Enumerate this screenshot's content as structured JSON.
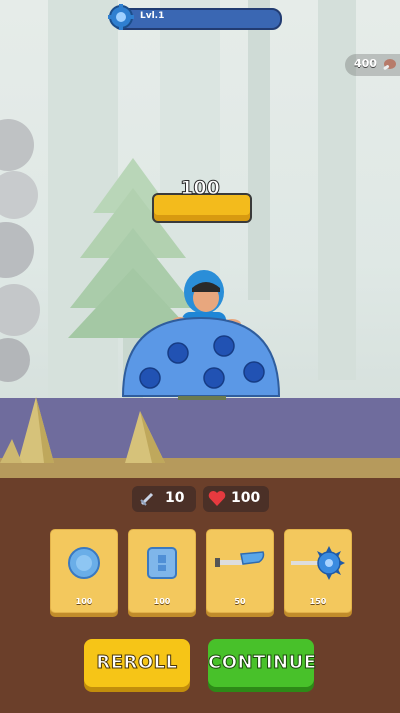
{
  "hud": {
    "level_label": "Lvl.1",
    "coins": "400"
  },
  "enemy": {
    "hp_value": "100"
  },
  "stats": {
    "attack": "10",
    "health": "100"
  },
  "shop": {
    "items": [
      {
        "icon": "blue-disc-icon",
        "price": "100"
      },
      {
        "icon": "blue-armor-block-icon",
        "price": "100"
      },
      {
        "icon": "blue-blaster-icon",
        "price": "50"
      },
      {
        "icon": "spiked-mace-icon",
        "price": "150"
      }
    ]
  },
  "buttons": {
    "reroll": "REROLL",
    "continue": "CONTINUE"
  },
  "colors": {
    "panel": "#6b3f2a",
    "card": "#f3c85d",
    "reroll": "#f6c517",
    "continue": "#48c12a",
    "hp_bar": "#f3bb1c",
    "level_bar": "#3a67b3"
  }
}
